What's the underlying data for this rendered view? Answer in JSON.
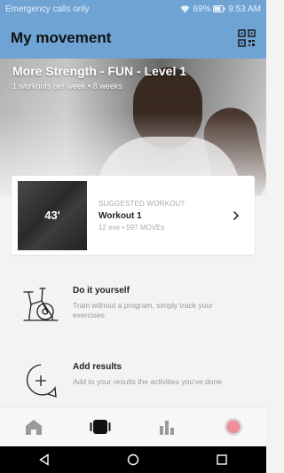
{
  "status_bar": {
    "carrier": "Emergency calls only",
    "battery": "69%",
    "time": "9:53 AM"
  },
  "header": {
    "title": "My movement",
    "qr_icon": "qr-code-icon"
  },
  "hero": {
    "title": "More Strength - FUN - Level 1",
    "subtitle": "1 workouts per week • 8 weeks"
  },
  "suggested": {
    "label": "SUGGESTED WORKOUT",
    "duration": "43'",
    "title": "Workout 1",
    "meta": "12 exe • 597 MOVEs"
  },
  "options": [
    {
      "title": "Do it yourself",
      "description": "Train without a program, simply track your exercises",
      "icon": "exercise-bike-icon"
    },
    {
      "title": "Add results",
      "description": "Add to your results the activities you've done",
      "icon": "add-results-icon"
    }
  ],
  "bottom_nav": [
    {
      "icon": "home-icon"
    },
    {
      "icon": "my-movement-icon"
    },
    {
      "icon": "stats-icon"
    },
    {
      "icon": "profile-icon"
    }
  ],
  "colors": {
    "header": "#6ea3d4",
    "active_nav": "#111111",
    "inactive_nav": "#9a9a9a",
    "profile_dot": "#ea8f9b"
  }
}
